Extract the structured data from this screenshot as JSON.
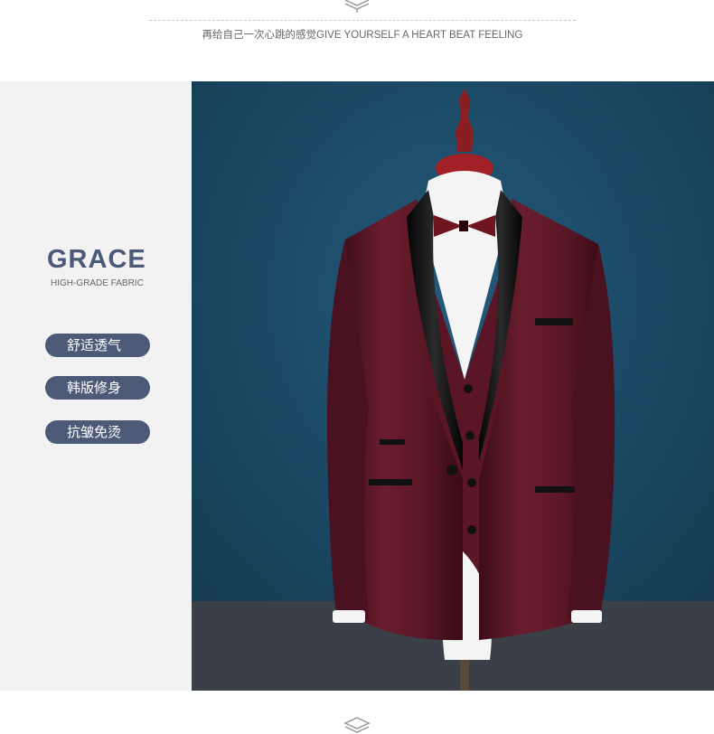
{
  "header": {
    "tagline": "再给自己一次心跳的感觉GIVE YOURSELF A HEART BEAT FEELING",
    "icon": "stacked-box-icon"
  },
  "side_panel": {
    "brand": "GRACE",
    "brand_subtitle": "HIGH-GRADE FABRIC",
    "features": [
      {
        "label": "舒适透气"
      },
      {
        "label": "韩版修身"
      },
      {
        "label": "抗皱免烫"
      }
    ],
    "pill_color": "#4c5a78",
    "panel_color": "#f2f2f2"
  },
  "product_photo": {
    "background_color": "#1c4a63",
    "suit_color": "#5a1626",
    "lapel_color": "#111111"
  },
  "footer": {
    "icon": "stacked-box-icon"
  }
}
